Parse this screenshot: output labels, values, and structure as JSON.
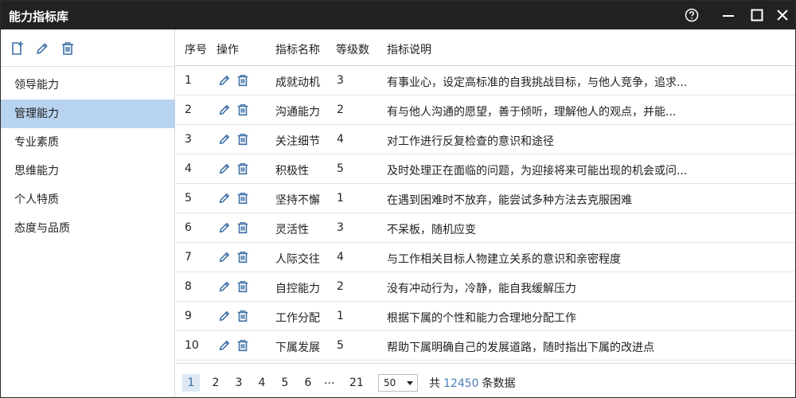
{
  "window": {
    "title": "能力指标库"
  },
  "colors": {
    "accent": "#3b6fa6",
    "selected_bg": "#b8d3ef",
    "titlebar_bg": "#222222"
  },
  "sidebar": {
    "items": [
      {
        "label": "领导能力",
        "selected": false
      },
      {
        "label": "管理能力",
        "selected": true
      },
      {
        "label": "专业素质",
        "selected": false
      },
      {
        "label": "思维能力",
        "selected": false
      },
      {
        "label": "个人特质",
        "selected": false
      },
      {
        "label": "态度与品质",
        "selected": false
      }
    ]
  },
  "table": {
    "headers": {
      "index": "序号",
      "actions": "操作",
      "name": "指标名称",
      "level": "等级数",
      "desc": "指标说明"
    },
    "rows": [
      {
        "index": "1",
        "name": "成就动机",
        "level": "3",
        "desc": "有事业心，设定高标准的自我挑战目标，与他人竞争，追求..."
      },
      {
        "index": "2",
        "name": "沟通能力",
        "level": "2",
        "desc": "有与他人沟通的愿望，善于倾听，理解他人的观点，并能..."
      },
      {
        "index": "3",
        "name": "关注细节",
        "level": "4",
        "desc": "对工作进行反复检查的意识和途径"
      },
      {
        "index": "4",
        "name": "积极性",
        "level": "5",
        "desc": "及时处理正在面临的问题，为迎接将来可能出现的机会或问..."
      },
      {
        "index": "5",
        "name": "坚持不懈",
        "level": "1",
        "desc": "在遇到困难时不放弃，能尝试多种方法去克服困难"
      },
      {
        "index": "6",
        "name": "灵活性",
        "level": "3",
        "desc": "不呆板，随机应变"
      },
      {
        "index": "7",
        "name": "人际交往",
        "level": "4",
        "desc": "与工作相关目标人物建立关系的意识和亲密程度"
      },
      {
        "index": "8",
        "name": "自控能力",
        "level": "2",
        "desc": "没有冲动行为，冷静，能自我缓解压力"
      },
      {
        "index": "9",
        "name": "工作分配",
        "level": "1",
        "desc": "根据下属的个性和能力合理地分配工作"
      },
      {
        "index": "10",
        "name": "下属发展",
        "level": "5",
        "desc": "帮助下属明确自己的发展道路，随时指出下属的改进点"
      }
    ]
  },
  "pager": {
    "pages": [
      "1",
      "2",
      "3",
      "4",
      "5",
      "6"
    ],
    "current": "1",
    "ellipsis": "...",
    "last": "21",
    "page_size": "50",
    "total_prefix": "共",
    "total_count": "12450",
    "total_suffix": "条数据"
  },
  "icons": {
    "toolbar": [
      "add-icon",
      "edit-icon",
      "delete-icon"
    ],
    "row_actions": [
      "edit-icon",
      "delete-icon"
    ],
    "window": [
      "help-icon",
      "minimize-icon",
      "maximize-icon",
      "close-icon"
    ]
  }
}
